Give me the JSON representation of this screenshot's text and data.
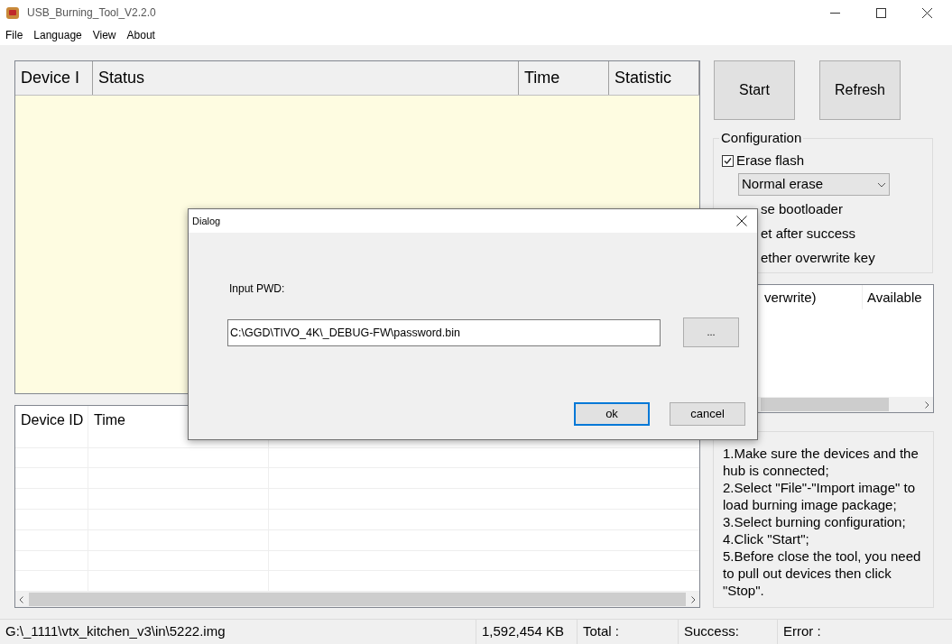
{
  "window": {
    "title": "USB_Burning_Tool_V2.2.0"
  },
  "menu": [
    "File",
    "Language",
    "View",
    "About"
  ],
  "device_table": {
    "columns": [
      "Device I",
      "Status",
      "Time",
      "Statistic"
    ]
  },
  "buttons": [
    "Start",
    "Refresh"
  ],
  "configuration": {
    "title": "Configuration",
    "items": [
      {
        "kind": "checkbox",
        "label": "Erase flash",
        "checked": true
      },
      {
        "kind": "select",
        "value": "Normal erase"
      },
      {
        "kind": "fragment",
        "label": "se bootloader"
      },
      {
        "kind": "fragment",
        "label": "et after success"
      },
      {
        "kind": "fragment",
        "label": "ether overwrite key"
      }
    ]
  },
  "key_table": {
    "columns": [
      "verwrite)",
      "Available"
    ]
  },
  "log_table": {
    "columns": [
      "Device ID",
      "Time"
    ]
  },
  "instructions": [
    "1.Make sure the devices and the hub is connected;",
    "2.Select \"File\"-\"Import image\" to load burning image package;",
    "3.Select burning configuration;",
    "4.Click \"Start\";",
    "5.Before close the tool, you need to pull out devices then click \"Stop\"."
  ],
  "status_bar": [
    "G:\\_1111\\vtx_kitchen_v3\\in\\5222.img",
    "1,592,454 KB",
    "Total :",
    "Success:",
    "Error :"
  ],
  "dialog": {
    "title": "Dialog",
    "label": "Input PWD:",
    "path": "C:\\GGD\\TIVO_4K\\_DEBUG-FW\\password.bin",
    "browse": "...",
    "ok": "ok",
    "cancel": "cancel"
  }
}
